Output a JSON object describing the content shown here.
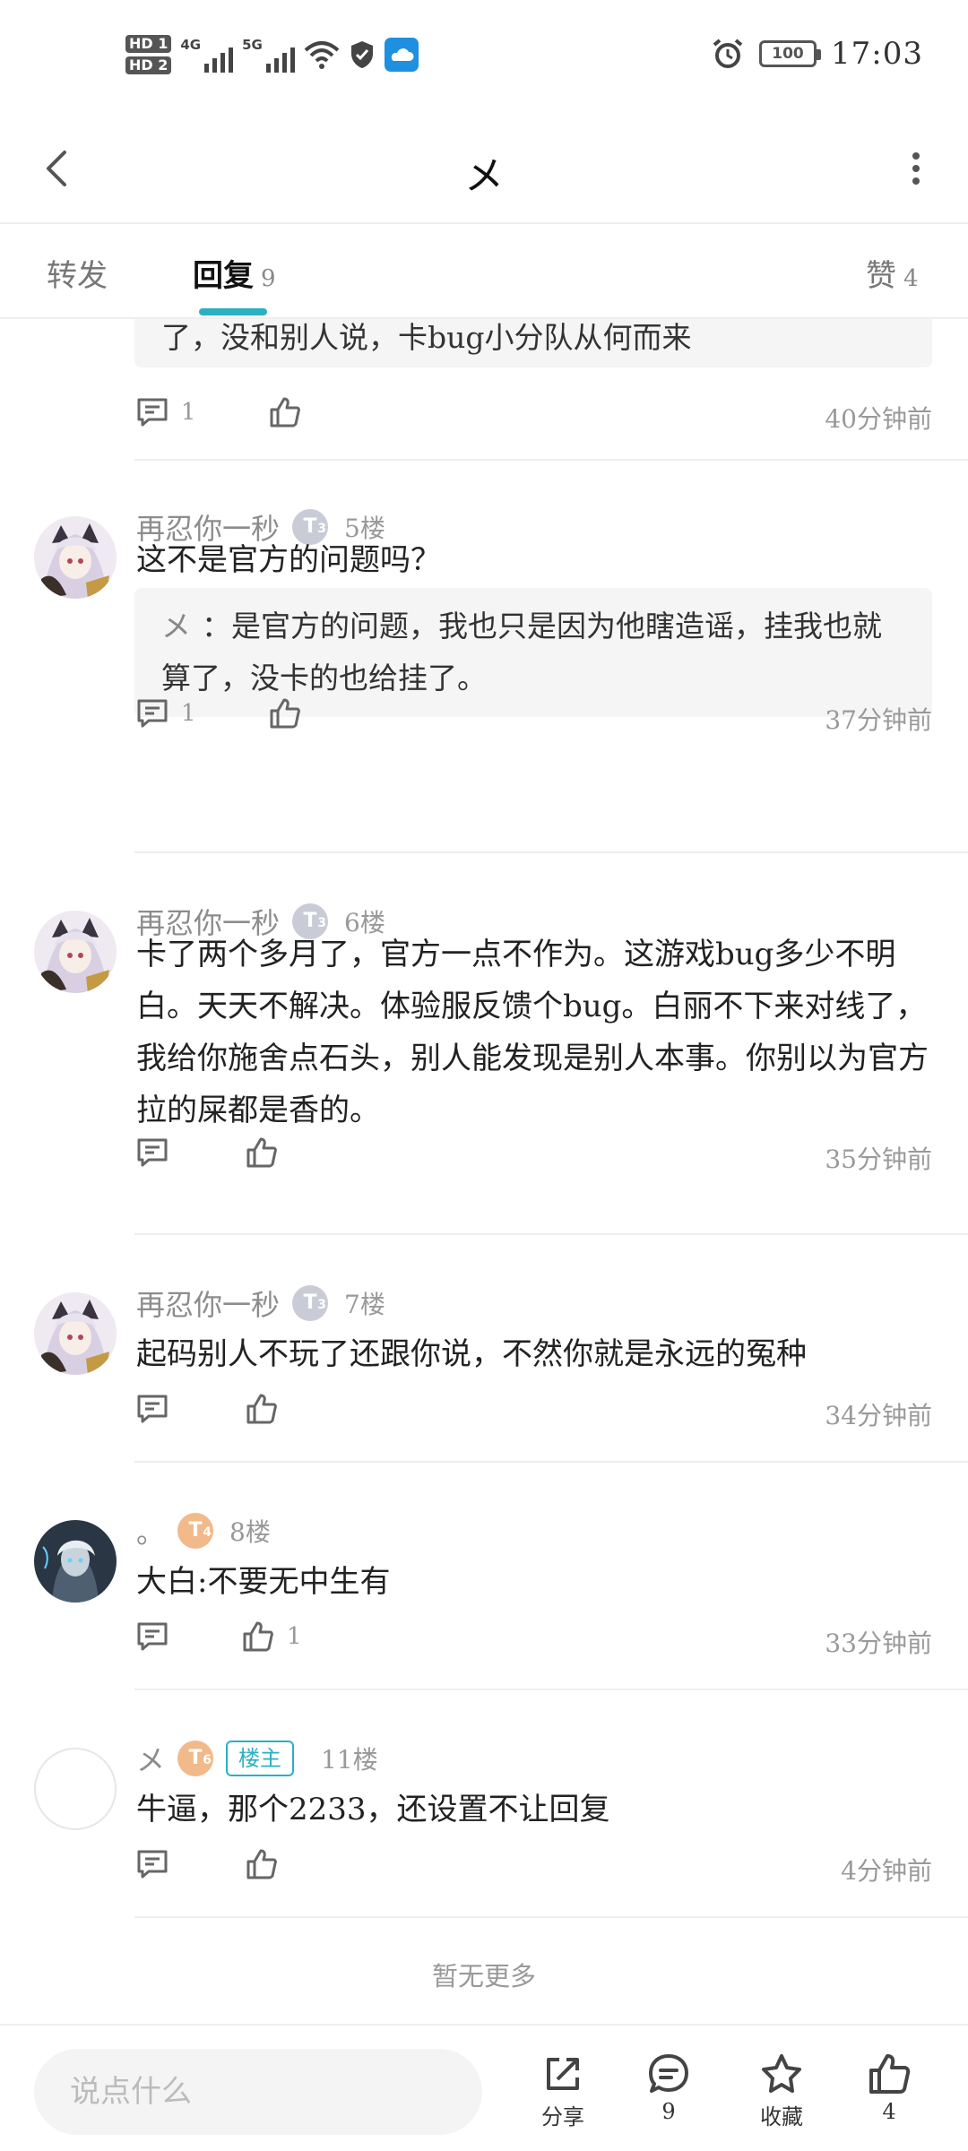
{
  "status_bar": {
    "hd1": "HD 1",
    "hd2": "HD 2",
    "net1": "4G",
    "net2": "5G",
    "battery": "100",
    "time": "17:03"
  },
  "header": {
    "title": "メ"
  },
  "tabs": [
    {
      "label": "转发",
      "count": ""
    },
    {
      "label": "回复",
      "count": "9"
    },
    {
      "label": "赞",
      "count": "4"
    }
  ],
  "colors": {
    "accent": "#2bb0c3",
    "level_silver": "#c9ccd6",
    "level_gold": "#f2b98a"
  },
  "top_fragment": {
    "quote_text": "了，没和别人说，卡bug小分队从何而来",
    "reply_count": "1",
    "time": "40分钟前"
  },
  "comments": [
    {
      "username": "再忍你一秒",
      "level": "T",
      "level_sub": "3",
      "floor": "5楼",
      "text": "这不是官方的问题吗？",
      "quote_name": "メ",
      "quote_text": "：是官方的问题，我也只是因为他瞎造谣，挂我也就算了，没卡的也给挂了。",
      "reply_count": "1",
      "like_count": "",
      "time": "37分钟前"
    },
    {
      "username": "再忍你一秒",
      "level": "T",
      "level_sub": "3",
      "floor": "6楼",
      "text": "卡了两个多月了，官方一点不作为。这游戏bug多少不明白。天天不解决。体验服反馈个bug。白丽不下来对线了，我给你施舍点石头，别人能发现是别人本事。你别以为官方拉的屎都是香的。",
      "reply_count": "",
      "like_count": "",
      "time": "35分钟前"
    },
    {
      "username": "再忍你一秒",
      "level": "T",
      "level_sub": "3",
      "floor": "7楼",
      "text": "起码别人不玩了还跟你说，不然你就是永远的冤种",
      "reply_count": "",
      "like_count": "",
      "time": "34分钟前"
    },
    {
      "username": "。",
      "level": "T",
      "level_sub": "4",
      "floor": "8楼",
      "text": "大白:不要无中生有",
      "reply_count": "",
      "like_count": "1",
      "time": "33分钟前"
    },
    {
      "username": "メ",
      "level": "T",
      "level_sub": "6",
      "badge": "楼主",
      "floor": "11楼",
      "text": "牛逼，那个2233，还设置不让回复",
      "reply_count": "",
      "like_count": "",
      "time": "4分钟前"
    }
  ],
  "no_more": "暂无更多",
  "bottom_bar": {
    "input_placeholder": "说点什么",
    "share_label": "分享",
    "comment_count": "9",
    "favorite_label": "收藏",
    "like_count": "4"
  }
}
